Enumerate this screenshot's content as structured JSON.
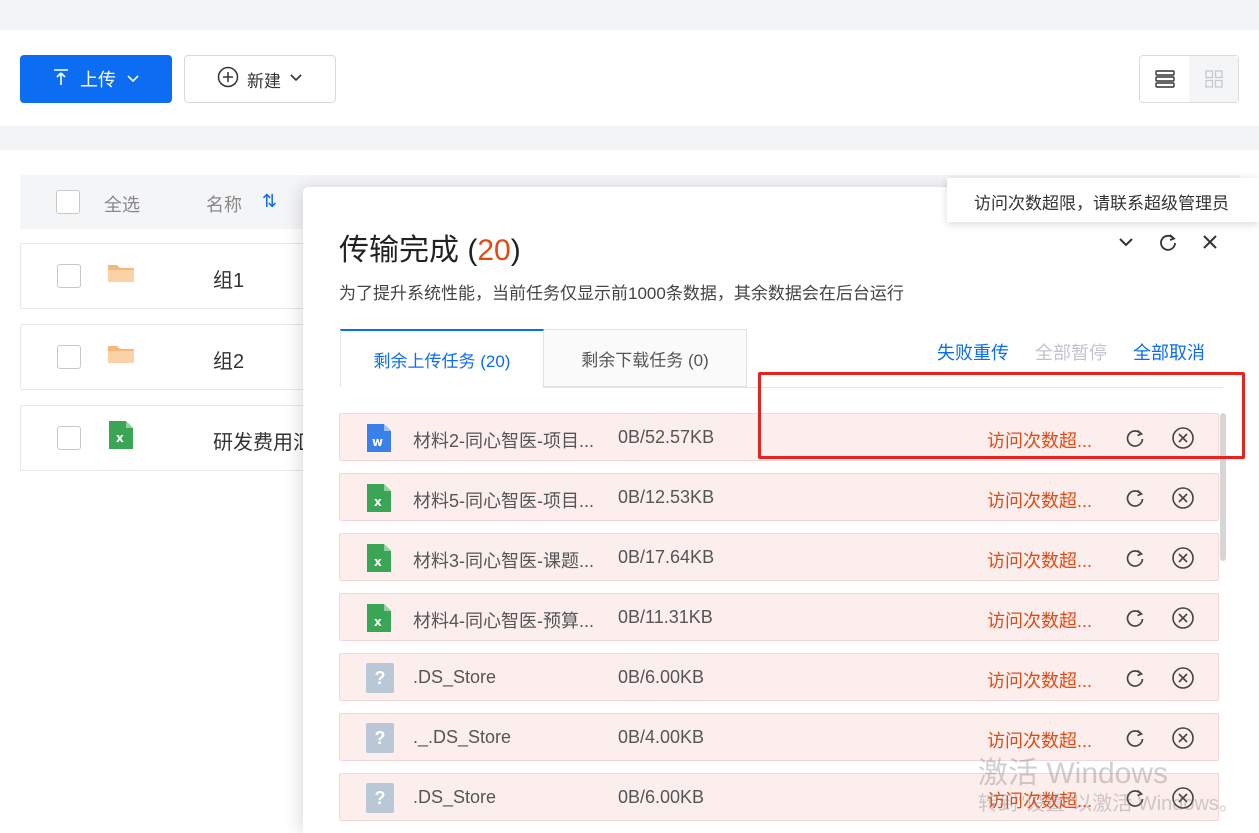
{
  "toolbar": {
    "upload_label": "上传",
    "new_label": "新建"
  },
  "list": {
    "select_all": "全选",
    "name_header": "名称",
    "sort_glyph": "⇅",
    "rows": [
      {
        "name": "组1",
        "icon": "folder-icon"
      },
      {
        "name": "组2",
        "icon": "folder-icon"
      },
      {
        "name": "研发费用汇",
        "icon": "excel-file-icon"
      }
    ]
  },
  "panel": {
    "title": "传输完成 (",
    "count": "20",
    "title_close": ")",
    "description": "为了提升系统性能，当前任务仅显示前1000条数据，其余数据会在后台运行",
    "tabs": [
      {
        "label": "剩余上传任务 (20)",
        "active": true
      },
      {
        "label": "剩余下载任务 (0)",
        "active": false
      }
    ],
    "actions": {
      "retry_failed": "失败重传",
      "pause_all": "全部暂停",
      "cancel_all": "全部取消"
    },
    "tooltip": "访问次数超限，请联系超级管理员",
    "tasks": [
      {
        "name": "材料2-同心智医-项目...",
        "size": "0B/52.57KB",
        "status": "访问次数超...",
        "icon": "word-file-icon"
      },
      {
        "name": "材料5-同心智医-项目...",
        "size": "0B/12.53KB",
        "status": "访问次数超...",
        "icon": "excel-file-icon"
      },
      {
        "name": "材料3-同心智医-课题...",
        "size": "0B/17.64KB",
        "status": "访问次数超...",
        "icon": "excel-file-icon"
      },
      {
        "name": "材料4-同心智医-预算...",
        "size": "0B/11.31KB",
        "status": "访问次数超...",
        "icon": "excel-file-icon"
      },
      {
        "name": ".DS_Store",
        "size": "0B/6.00KB",
        "status": "访问次数超...",
        "icon": "unknown-file-icon"
      },
      {
        "name": "._.DS_Store",
        "size": "0B/4.00KB",
        "status": "访问次数超...",
        "icon": "unknown-file-icon"
      },
      {
        "name": ".DS_Store",
        "size": "0B/6.00KB",
        "status": "访问次数超...",
        "icon": "unknown-file-icon"
      }
    ]
  },
  "watermark": {
    "line1": "激活 Windows",
    "line2": "转到\"设置\"以激活 Windows。"
  },
  "colors": {
    "primary": "#0c6cf2",
    "error": "#e24a12",
    "task_bg": "#fdeeee",
    "highlight_box": "#e8231f"
  }
}
